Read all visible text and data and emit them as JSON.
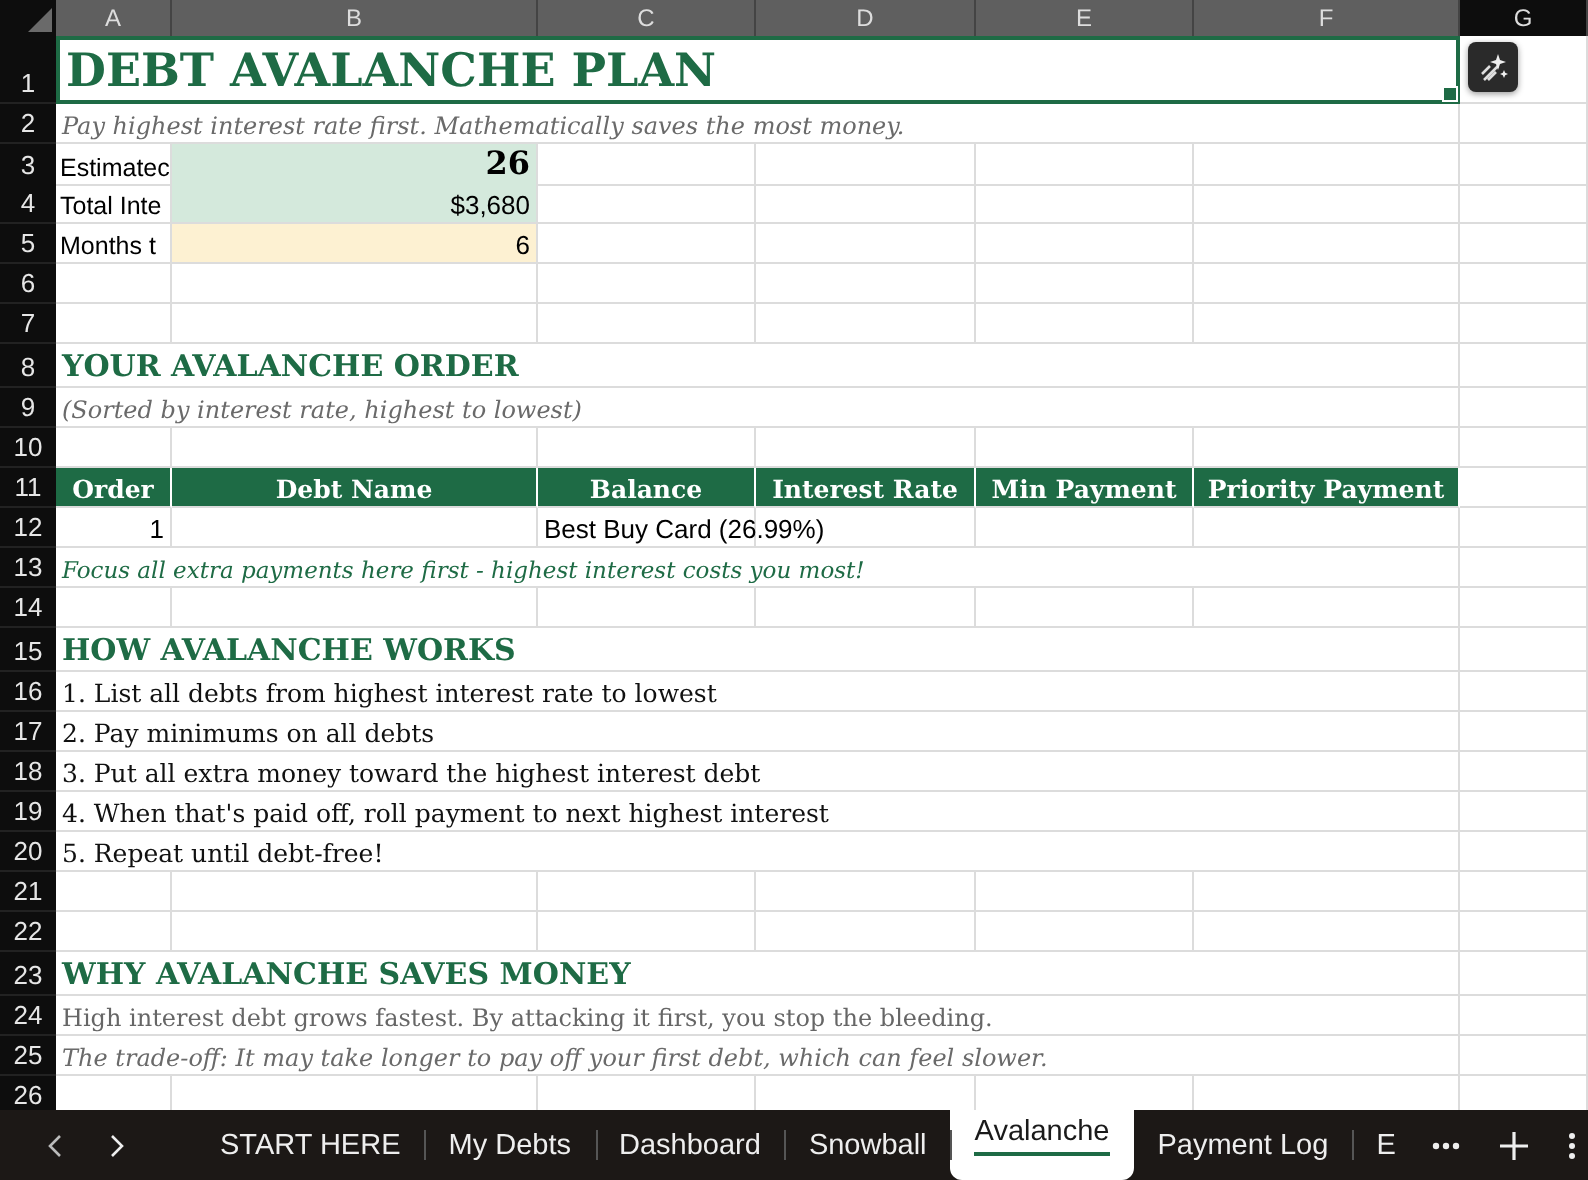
{
  "columns": [
    {
      "label": "A",
      "selected": true
    },
    {
      "label": "B",
      "selected": true
    },
    {
      "label": "C",
      "selected": true
    },
    {
      "label": "D",
      "selected": true
    },
    {
      "label": "E",
      "selected": true
    },
    {
      "label": "F",
      "selected": true
    },
    {
      "label": "G",
      "selected": false
    }
  ],
  "rows": [
    {
      "num": "1",
      "cells": {
        "A": {
          "kind": "title",
          "text": "DEBT AVALANCHE PLAN"
        }
      }
    },
    {
      "num": "2",
      "cells": {
        "A": {
          "kind": "subtitle",
          "text": "Pay highest interest rate first. Mathematically saves the most money."
        }
      }
    },
    {
      "num": "3",
      "cells": {
        "A": {
          "kind": "label",
          "text": "Estimatec"
        },
        "B": {
          "kind": "metric-big",
          "text": "26"
        }
      }
    },
    {
      "num": "4",
      "cells": {
        "A": {
          "kind": "label",
          "text": "Total Inte"
        },
        "B": {
          "kind": "metric",
          "text": "$3,680"
        }
      }
    },
    {
      "num": "5",
      "cells": {
        "A": {
          "kind": "label",
          "text": "Months t"
        },
        "B": {
          "kind": "metric-warn",
          "text": "6"
        }
      }
    },
    {
      "num": "6",
      "cells": {}
    },
    {
      "num": "7",
      "cells": {}
    },
    {
      "num": "8",
      "cells": {
        "A": {
          "kind": "heading",
          "text": "YOUR AVALANCHE ORDER"
        }
      }
    },
    {
      "num": "9",
      "cells": {
        "A": {
          "kind": "subtitle",
          "text": "(Sorted by interest rate, highest to lowest)"
        }
      }
    },
    {
      "num": "10",
      "cells": {}
    },
    {
      "num": "11",
      "cells": {
        "A": {
          "kind": "th",
          "text": "Order"
        },
        "B": {
          "kind": "th",
          "text": "Debt Name"
        },
        "C": {
          "kind": "th",
          "text": "Balance"
        },
        "D": {
          "kind": "th",
          "text": "Interest Rate"
        },
        "E": {
          "kind": "th",
          "text": "Min Payment"
        },
        "F": {
          "kind": "th",
          "text": "Priority Payment"
        }
      }
    },
    {
      "num": "12",
      "cells": {
        "A": {
          "kind": "number",
          "text": "1"
        },
        "C": {
          "kind": "plain",
          "text": "Best Buy Card (26.99%)"
        }
      }
    },
    {
      "num": "13",
      "cells": {
        "A": {
          "kind": "note",
          "text": "Focus all extra payments here first - highest interest costs you most!"
        }
      }
    },
    {
      "num": "14",
      "cells": {}
    },
    {
      "num": "15",
      "cells": {
        "A": {
          "kind": "heading",
          "text": "HOW AVALANCHE WORKS"
        }
      }
    },
    {
      "num": "16",
      "cells": {
        "A": {
          "kind": "body",
          "text": "1. List all debts from highest interest rate to lowest"
        }
      }
    },
    {
      "num": "17",
      "cells": {
        "A": {
          "kind": "body",
          "text": "2. Pay minimums on all debts"
        }
      }
    },
    {
      "num": "18",
      "cells": {
        "A": {
          "kind": "body",
          "text": "3. Put all extra money toward the highest interest debt"
        }
      }
    },
    {
      "num": "19",
      "cells": {
        "A": {
          "kind": "body",
          "text": "4. When that's paid off, roll payment to next highest interest"
        }
      }
    },
    {
      "num": "20",
      "cells": {
        "A": {
          "kind": "body",
          "text": "5. Repeat until debt-free!"
        }
      }
    },
    {
      "num": "21",
      "cells": {}
    },
    {
      "num": "22",
      "cells": {}
    },
    {
      "num": "23",
      "cells": {
        "A": {
          "kind": "heading",
          "text": "WHY AVALANCHE SAVES MONEY"
        }
      }
    },
    {
      "num": "24",
      "cells": {
        "A": {
          "kind": "grey",
          "text": "High interest debt grows fastest. By attacking it first, you stop the bleeding."
        }
      }
    },
    {
      "num": "25",
      "cells": {
        "A": {
          "kind": "subtitle",
          "text": "The trade-off: It may take longer to pay off your first debt, which can feel slower."
        }
      }
    },
    {
      "num": "26",
      "cells": {}
    }
  ],
  "sheet_tabs": [
    {
      "label": "START HERE",
      "selected": false
    },
    {
      "label": "My Debts",
      "selected": false
    },
    {
      "label": "Dashboard",
      "selected": false
    },
    {
      "label": "Snowball",
      "selected": false
    },
    {
      "label": "Avalanche",
      "selected": true
    },
    {
      "label": "Payment Log",
      "selected": false
    },
    {
      "label": "E",
      "selected": false
    }
  ]
}
